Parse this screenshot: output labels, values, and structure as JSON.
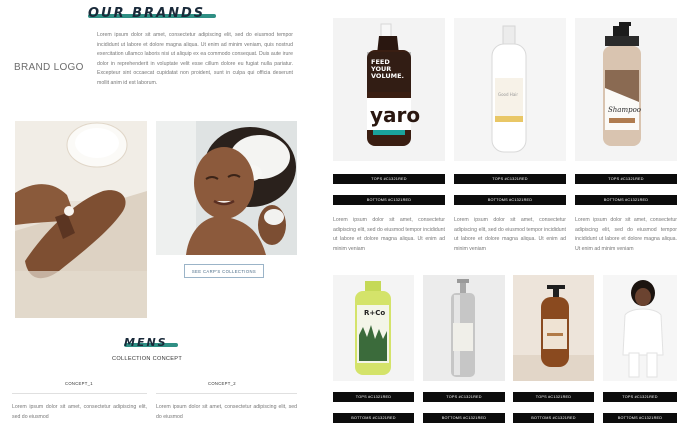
{
  "left": {
    "brand_title": "OUR BRANDS",
    "brand_logo": "BRAND LOGO",
    "brand_lorem": "Lorem ipsum dolor sit amet, consectetur adipiscing elit, sed do eiusmod tempor incididunt ut labore et dolore magna aliqua. Ut enim ad minim veniam, quis nostrud exercitation ullamco laboris nisi ut aliquip ex ea commodo consequat. Duis aute irure dolor in reprehenderit in voluptate velit esse cillum dolore eu fugiat nulla pariatur. Excepteur sint occaecat cupidatat non proident, sunt in culpa qui officia deserunt mollit anim id est laborum.",
    "cta_label": "SEE CARP'S COLLECTIONS",
    "mens_title": "MENS",
    "collection_label": "COLLECTION CONCEPT",
    "concepts": [
      {
        "label": "CONCEPT_1",
        "lorem": "Lorem ipsum dolor sit amet, consectetur adipiscing elit, sed do eiusmod"
      },
      {
        "label": "CONCEPT_2",
        "lorem": "Lorem ipsum dolor sit amet, consectetur adipiscing elit, sed do eiusmod"
      }
    ]
  },
  "right": {
    "row1": [
      {
        "bottle_label": "FEED YOUR VOLUME",
        "brand": "yaro",
        "tops": "TOPS #C1321RED",
        "bottoms": "BOTTOMS #C1321RED",
        "lorem": "Lorem ipsum dolor sit amet, consectetur adipiscing elit, sed do eiusmod tempor incididunt ut labore et dolore magna aliqua. Ut enim ad minim veniam"
      },
      {
        "bottle_label": "",
        "brand": "",
        "tops": "TOPS #C1321RED",
        "bottoms": "BOTTOMS #C1321RED",
        "lorem": "Lorem ipsum dolor sit amet, consectetur adipiscing elit, sed do eiusmod tempor incididunt ut labore et dolore magna aliqua. Ut enim ad minim veniam"
      },
      {
        "bottle_label": "Shampoo",
        "brand": "",
        "tops": "TOPS #C1321RED",
        "bottoms": "BOTTOMS #C1321RED",
        "lorem": "Lorem ipsum dolor sit amet, consectetur adipiscing elit, sed do eiusmod tempor incididunt ut labore et dolore magna aliqua. Ut enim ad minim veniam"
      }
    ],
    "row2": [
      {
        "brand": "R+Co",
        "tops": "TOPS #C1321RED",
        "bottoms": "BOTTOMS #C1321RED"
      },
      {
        "brand": "",
        "tops": "TOPS #C1321RED",
        "bottoms": "BOTTOMS #C1321RED"
      },
      {
        "brand": "",
        "tops": "TOPS #C1321RED",
        "bottoms": "BOTTOMS #C1321RED"
      },
      {
        "brand": "",
        "tops": "TOPS #C1321RED",
        "bottoms": "BOTTOMS #C1321RED"
      }
    ]
  },
  "colors": {
    "accent_teal": "#2f8f84",
    "bar_black": "#0c0c0c",
    "title_navy": "#1a2a3a"
  }
}
